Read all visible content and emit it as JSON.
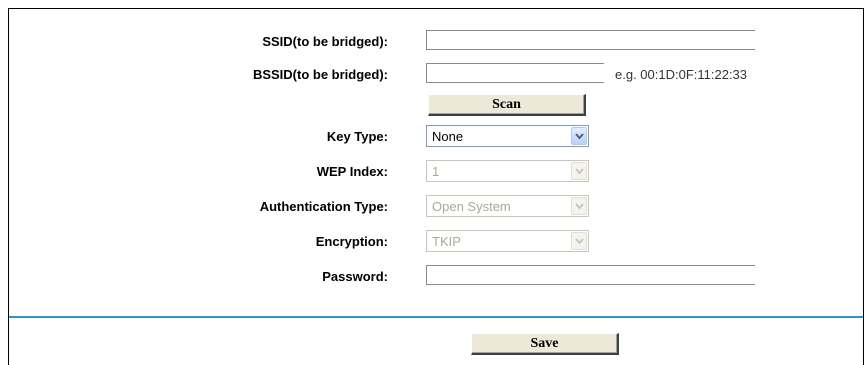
{
  "form": {
    "ssid": {
      "label": "SSID(to be bridged):",
      "value": ""
    },
    "bssid": {
      "label": "BSSID(to be bridged):",
      "value": "",
      "hint": "e.g. 00:1D:0F:11:22:33"
    },
    "scan_label": "Scan",
    "key_type": {
      "label": "Key Type:",
      "value": "None"
    },
    "wep_index": {
      "label": "WEP Index:",
      "value": "1"
    },
    "auth_type": {
      "label": "Authentication Type:",
      "value": "Open System"
    },
    "encryption": {
      "label": "Encryption:",
      "value": "TKIP"
    },
    "password": {
      "label": "Password:",
      "value": ""
    }
  },
  "footer": {
    "save_label": "Save"
  },
  "colors": {
    "divider": "#2b95c9",
    "button_face": "#ece9d8",
    "disabled_text": "#aca899"
  }
}
